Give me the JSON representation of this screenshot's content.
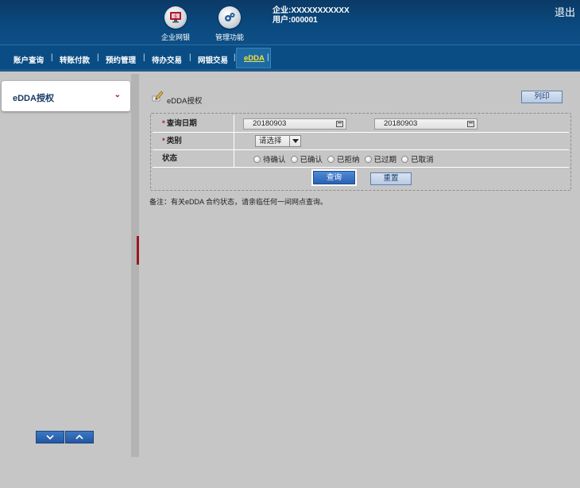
{
  "header": {
    "nav_icons": [
      {
        "label": "企业网银",
        "icon": "monitor-icon"
      },
      {
        "label": "管理功能",
        "icon": "gears-icon"
      }
    ],
    "company_line": "企业:XXXXXXXXXXX",
    "user_line": "用户:000001",
    "logout_label": "退出"
  },
  "nav": {
    "items": [
      "账户查询",
      "转账付款",
      "预约管理",
      "待办交易",
      "网银交易",
      "eDDA"
    ],
    "active": "eDDA",
    "active_color": "#f2e33a"
  },
  "sidebar": {
    "card_label": "eDDA授权",
    "accent_color": "#b0172b"
  },
  "page": {
    "title": "eDDA授权",
    "print_label": "列印"
  },
  "form": {
    "date_label": "查询日期",
    "date_from": "20180903",
    "date_to": "20180903",
    "type_label": "类别",
    "type_value": "请选择",
    "status_label": "状态",
    "status_options": [
      "待确认",
      "已确认",
      "已拒纳",
      "已过期",
      "已取消"
    ],
    "query_label": "查询",
    "reset_label": "重置"
  },
  "note": "备注：有关eDDA 合约状态，请亲临任何一间网点查询。"
}
